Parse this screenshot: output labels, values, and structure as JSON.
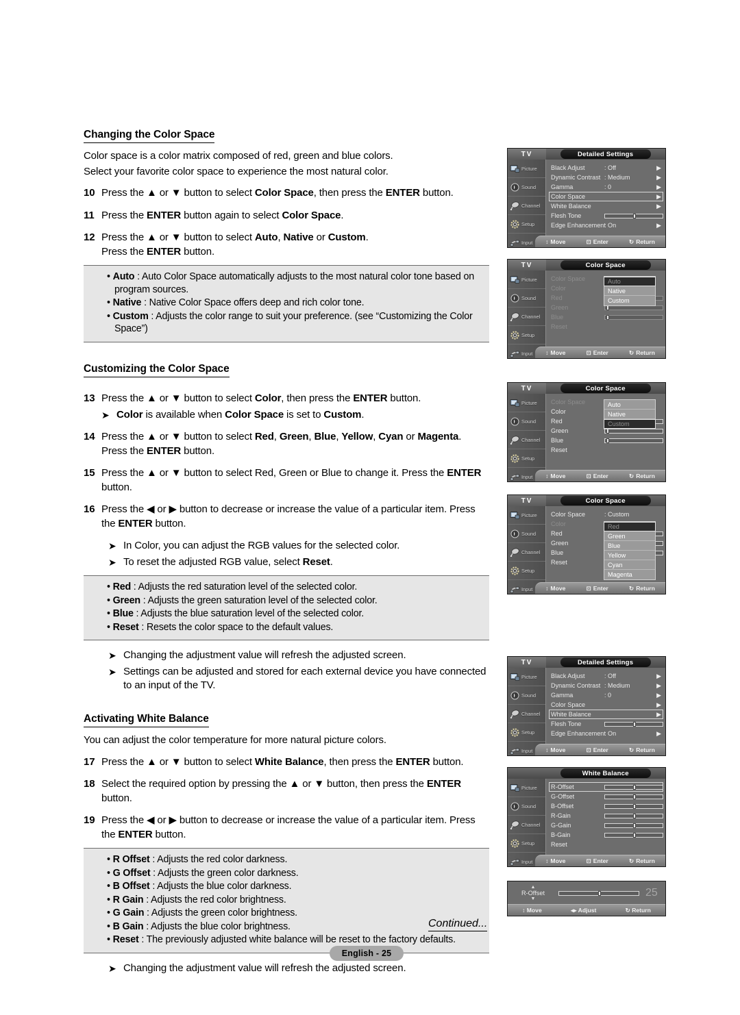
{
  "page": {
    "continued": "Continued...",
    "page_badge": "English - 25"
  },
  "sections": {
    "changing": {
      "heading": "Changing the Color Space",
      "lead1": "Color space is a color matrix composed of red, green and blue colors.",
      "lead2": "Select your favorite color space to experience the most natural color.",
      "steps": [
        {
          "num": "10",
          "text": "Press the ▲ or ▼ button to select Color Space, then press the ENTER button."
        },
        {
          "num": "11",
          "text": "Press the ENTER button again to select Color Space."
        },
        {
          "num": "12",
          "text": "Press the ▲ or ▼ button to select Auto, Native or Custom. Press the ENTER button."
        }
      ],
      "info": [
        {
          "term": "Auto",
          "desc": ": Auto Color Space automatically adjusts to the most natural color tone based on program sources."
        },
        {
          "term": "Native",
          "desc": ": Native Color Space offers deep and rich color tone."
        },
        {
          "term": "Custom",
          "desc": ": Adjusts the color range to suit your preference. (see “Customizing the Color Space”)"
        }
      ]
    },
    "customizing": {
      "heading": "Customizing the Color Space",
      "steps": [
        {
          "num": "13",
          "text": "Press the ▲ or ▼ button to select Color, then press the ENTER button."
        },
        {
          "num": "14",
          "text": "Press the ▲ or ▼ button to select Red, Green, Blue, Yellow, Cyan or Magenta. Press the ENTER button."
        },
        {
          "num": "15",
          "text": "Press the ▲ or ▼ button to select Red, Green or Blue to change it. Press the ENTER button."
        },
        {
          "num": "16",
          "text": "Press the ◀ or ▶ button to decrease or increase the value of a particular item. Press the ENTER button."
        }
      ],
      "note13": "Color is available when Color Space is set to Custom.",
      "note16a": "In Color, you can adjust the RGB values for the selected color.",
      "note16b": "To reset the adjusted RGB value, select Reset.",
      "info": [
        {
          "term": "Red",
          "desc": ": Adjusts the red saturation level of the selected color."
        },
        {
          "term": "Green",
          "desc": ": Adjusts the green saturation level of the selected color."
        },
        {
          "term": "Blue",
          "desc": ": Adjusts the blue saturation level of the selected color."
        },
        {
          "term": "Reset",
          "desc": ": Resets the color space to the default values."
        }
      ],
      "after_notes": [
        "Changing the adjustment value will refresh the adjusted screen.",
        "Settings can be adjusted and stored for each external device you have connected to an input of the TV."
      ]
    },
    "whitebalance": {
      "heading": "Activating White Balance",
      "lead1": "You can adjust the color temperature for more natural picture colors.",
      "steps": [
        {
          "num": "17",
          "text": "Press the ▲ or ▼ button to select White Balance, then press the ENTER button."
        },
        {
          "num": "18",
          "text": "Select the required option by pressing the ▲ or ▼ button, then press the ENTER button."
        },
        {
          "num": "19",
          "text": "Press the ◀ or ▶ button to decrease or increase the value of a particular item. Press the ENTER button."
        }
      ],
      "info": [
        {
          "term": "R Offset",
          "desc": ": Adjusts the red color darkness."
        },
        {
          "term": "G Offset",
          "desc": ": Adjusts the green color darkness."
        },
        {
          "term": "B Offset",
          "desc": ": Adjusts the blue color darkness."
        },
        {
          "term": "R Gain",
          "desc": ": Adjusts the red color brightness."
        },
        {
          "term": "G Gain",
          "desc": ": Adjusts the green color brightness."
        },
        {
          "term": "B Gain",
          "desc": ": Adjusts the blue color brightness."
        },
        {
          "term": "Reset",
          "desc": ": The previously adjusted white balance will be reset to the factory defaults."
        }
      ],
      "after_note": "Changing the adjustment value will refresh the adjusted screen."
    }
  },
  "osd_common": {
    "tv_label": "TV",
    "sidebar": [
      {
        "label": "Picture",
        "icon": "picture-icon"
      },
      {
        "label": "Sound",
        "icon": "sound-icon"
      },
      {
        "label": "Channel",
        "icon": "channel-icon"
      },
      {
        "label": "Setup",
        "icon": "setup-icon"
      },
      {
        "label": "Input",
        "icon": "input-icon"
      }
    ],
    "footer": {
      "move": "Move",
      "enter": "Enter",
      "return": "Return",
      "adjust": "Adjust"
    }
  },
  "osd": {
    "detailed_settings_1": {
      "title": "Detailed Settings",
      "rows": [
        {
          "label": "Black Adjust",
          "value": ": Off",
          "chevron": true
        },
        {
          "label": "Dynamic Contrast",
          "value": ": Medium",
          "chevron": true
        },
        {
          "label": "Gamma",
          "value": ": 0",
          "chevron": true
        },
        {
          "label": "Color Space",
          "value": "",
          "chevron": true,
          "selected": true
        },
        {
          "label": "White Balance",
          "value": "",
          "chevron": true
        },
        {
          "label": "Flesh Tone",
          "value": "",
          "slider": 50,
          "number": "0"
        },
        {
          "label": "Edge Enhancement",
          "value": ": On",
          "chevron": true
        }
      ]
    },
    "color_space_auto": {
      "title": "Color Space",
      "rows": [
        {
          "label": "Color Space",
          "value": ":",
          "dim": true
        },
        {
          "label": "Color",
          "value": ":",
          "dim": true
        },
        {
          "label": "Red",
          "value": "",
          "slider": 50,
          "number": "50",
          "dim": true
        },
        {
          "label": "Green",
          "value": "",
          "slider": 3,
          "number": "0",
          "dim": true
        },
        {
          "label": "Blue",
          "value": "",
          "slider": 3,
          "number": "0",
          "dim": true
        },
        {
          "label": "Reset",
          "value": "",
          "dim": true
        }
      ],
      "popup": {
        "items": [
          "Auto",
          "Native",
          "Custom"
        ],
        "active": "Auto"
      }
    },
    "color_space_custom": {
      "title": "Color Space",
      "rows": [
        {
          "label": "Color Space",
          "value": ":",
          "dim": true
        },
        {
          "label": "Color",
          "value": ":"
        },
        {
          "label": "Red",
          "value": "",
          "slider": 50,
          "number": "50"
        },
        {
          "label": "Green",
          "value": "",
          "slider": 3,
          "number": "0"
        },
        {
          "label": "Blue",
          "value": "",
          "slider": 3,
          "number": "0"
        },
        {
          "label": "Reset",
          "value": ""
        }
      ],
      "popup": {
        "items": [
          "Auto",
          "Native",
          "Custom"
        ],
        "active": "Custom"
      }
    },
    "color_space_colors": {
      "title": "Color Space",
      "rows": [
        {
          "label": "Color Space",
          "value": ": Custom"
        },
        {
          "label": "Color",
          "value": ":",
          "dim": true
        },
        {
          "label": "Red",
          "value": "",
          "slider": 50,
          "number": "50"
        },
        {
          "label": "Green",
          "value": "",
          "slider": 3,
          "number": "0"
        },
        {
          "label": "Blue",
          "value": "",
          "slider": 3,
          "number": "0"
        },
        {
          "label": "Reset",
          "value": ""
        }
      ],
      "popup": {
        "items": [
          "Red",
          "Green",
          "Blue",
          "Yellow",
          "Cyan",
          "Magenta"
        ],
        "active": "Red"
      }
    },
    "detailed_settings_2": {
      "title": "Detailed Settings",
      "rows": [
        {
          "label": "Black Adjust",
          "value": ": Off",
          "chevron": true
        },
        {
          "label": "Dynamic Contrast",
          "value": ": Medium",
          "chevron": true
        },
        {
          "label": "Gamma",
          "value": ": 0",
          "chevron": true
        },
        {
          "label": "Color Space",
          "value": "",
          "chevron": true
        },
        {
          "label": "White Balance",
          "value": "",
          "chevron": true,
          "selected": true
        },
        {
          "label": "Flesh Tone",
          "value": "",
          "slider": 50,
          "number": "0"
        },
        {
          "label": "Edge Enhancement",
          "value": ": On",
          "chevron": true
        }
      ]
    },
    "white_balance": {
      "title": "White Balance",
      "rows": [
        {
          "label": "R-Offset",
          "slider": 50,
          "number": "25",
          "selected": true
        },
        {
          "label": "G-Offset",
          "slider": 50,
          "number": "25"
        },
        {
          "label": "B-Offset",
          "slider": 50,
          "number": "25"
        },
        {
          "label": "R-Gain",
          "slider": 50,
          "number": "25"
        },
        {
          "label": "G-Gain",
          "slider": 50,
          "number": "25"
        },
        {
          "label": "B-Gain",
          "slider": 50,
          "number": "25"
        },
        {
          "label": "Reset"
        }
      ]
    },
    "adjust_bar": {
      "label": "R-Offset",
      "value": "25",
      "slider": 50
    }
  }
}
